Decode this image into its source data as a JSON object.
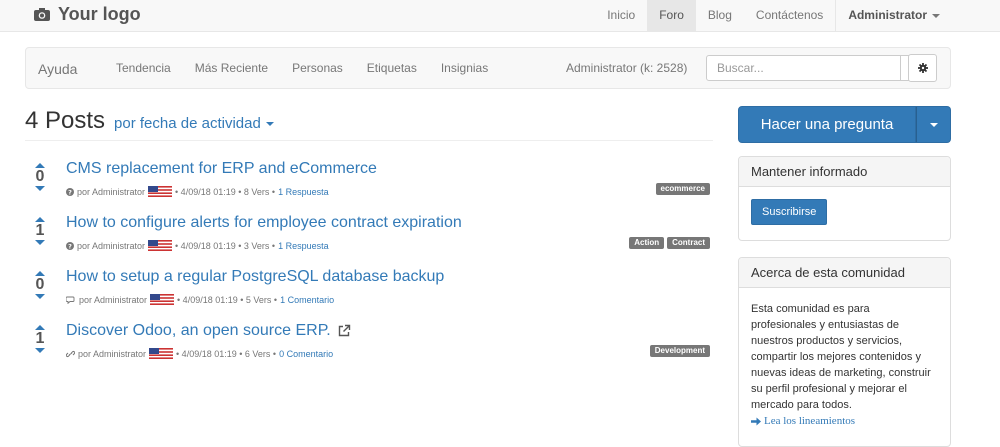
{
  "topbar": {
    "logo": "Your logo",
    "nav": [
      "Inicio",
      "Foro",
      "Blog",
      "Contáctenos"
    ],
    "user": "Administrator"
  },
  "forumbar": {
    "brand": "Ayuda",
    "links": [
      "Tendencia",
      "Más Reciente",
      "Personas",
      "Etiquetas",
      "Insignias"
    ],
    "karma": "Administrator (k: 2528)",
    "search_placeholder": "Buscar..."
  },
  "heading": {
    "count": "4 Posts",
    "sort": "por fecha de actividad"
  },
  "posts": [
    {
      "votes": "0",
      "title": "CMS replacement for ERP and eCommerce",
      "author": "por Administrator",
      "info": "• 4/09/18 01:19 • 8 Vers •",
      "link": "1 Respuesta",
      "tags": [
        "ecommerce"
      ],
      "icon": "question-circle-icon"
    },
    {
      "votes": "1",
      "title": "How to configure alerts for employee contract expiration",
      "author": "por Administrator",
      "info": "• 4/09/18 01:19 • 3 Vers •",
      "link": "1 Respuesta",
      "tags": [
        "Action",
        "Contract"
      ],
      "icon": "question-circle-icon"
    },
    {
      "votes": "0",
      "title": "How to setup a regular PostgreSQL database backup",
      "author": "por Administrator",
      "info": "• 4/09/18 01:19 • 5 Vers •",
      "link": "1 Comentario",
      "tags": [],
      "icon": "comments-icon"
    },
    {
      "votes": "1",
      "title": "Discover Odoo, an open source ERP.",
      "author": "por Administrator",
      "info": "• 4/09/18 01:19 • 6 Vers •",
      "link": "0 Comentario",
      "tags": [
        "Development"
      ],
      "icon": "link-icon"
    }
  ],
  "sidebar": {
    "ask": "Hacer una pregunta",
    "follow_title": "Mantener informado",
    "subscribe": "Suscribirse",
    "about_title": "Acerca de esta comunidad",
    "about_text": "Esta comunidad es para profesionales y entusiastas de nuestros productos y servicios, compartir los mejores contenidos y nuevas ideas de marketing, construir su perfil profesional y mejorar el mercado para todos.",
    "guidelines": "Lea los lineamientos"
  },
  "colors": {
    "brand_blue": "#337ab7",
    "tag_gray": "#777777"
  }
}
